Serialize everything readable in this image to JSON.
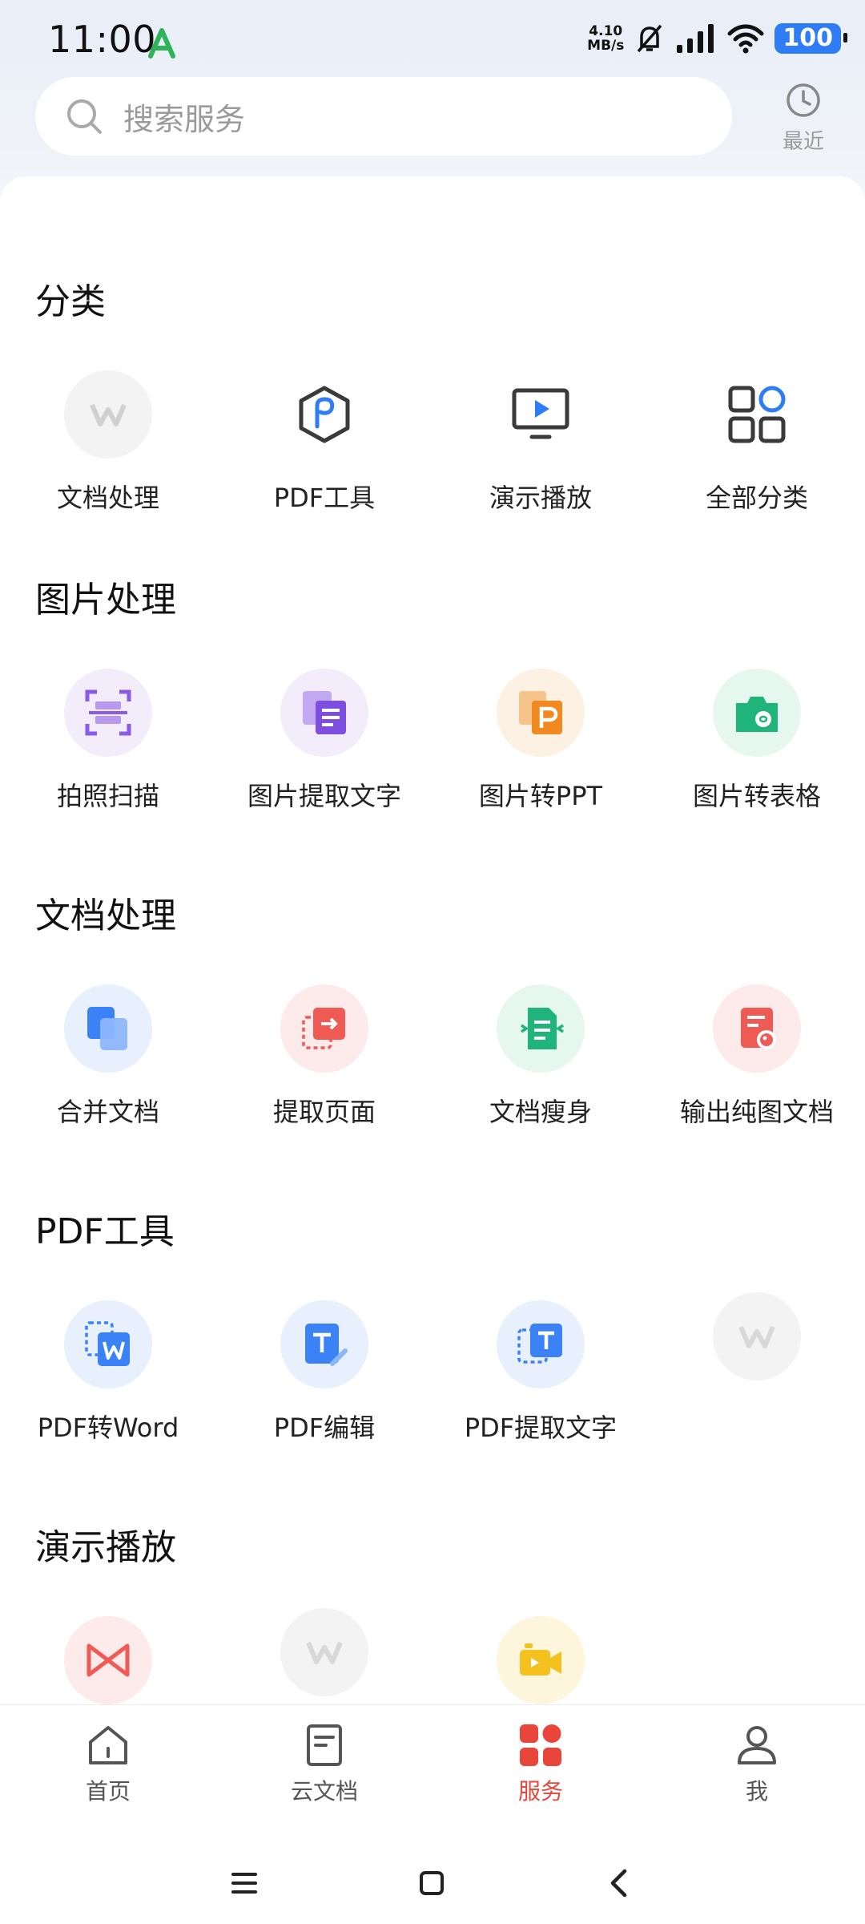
{
  "status_bar": {
    "time": "11:00",
    "net_speed_value": "4.10",
    "net_speed_unit": "MB/s",
    "battery": "100"
  },
  "search": {
    "placeholder": "搜索服务"
  },
  "recent": {
    "label": "最近"
  },
  "sections": {
    "category": {
      "title": "分类",
      "items": [
        "文档处理",
        "PDF工具",
        "演示播放",
        "全部分类"
      ]
    },
    "image": {
      "title": "图片处理",
      "items": [
        "拍照扫描",
        "图片提取文字",
        "图片转PPT",
        "图片转表格"
      ]
    },
    "doc": {
      "title": "文档处理",
      "items": [
        "合并文档",
        "提取页面",
        "文档瘦身",
        "输出纯图文档"
      ]
    },
    "pdf": {
      "title": "PDF工具",
      "items": [
        "PDF转Word",
        "PDF编辑",
        "PDF提取文字",
        ""
      ]
    },
    "present": {
      "title": "演示播放"
    }
  },
  "tabs": [
    "首页",
    "云文档",
    "服务",
    "我"
  ],
  "active_tab": "服务",
  "colors": {
    "accent": "#e8463a",
    "blue": "#2e7cf6"
  }
}
